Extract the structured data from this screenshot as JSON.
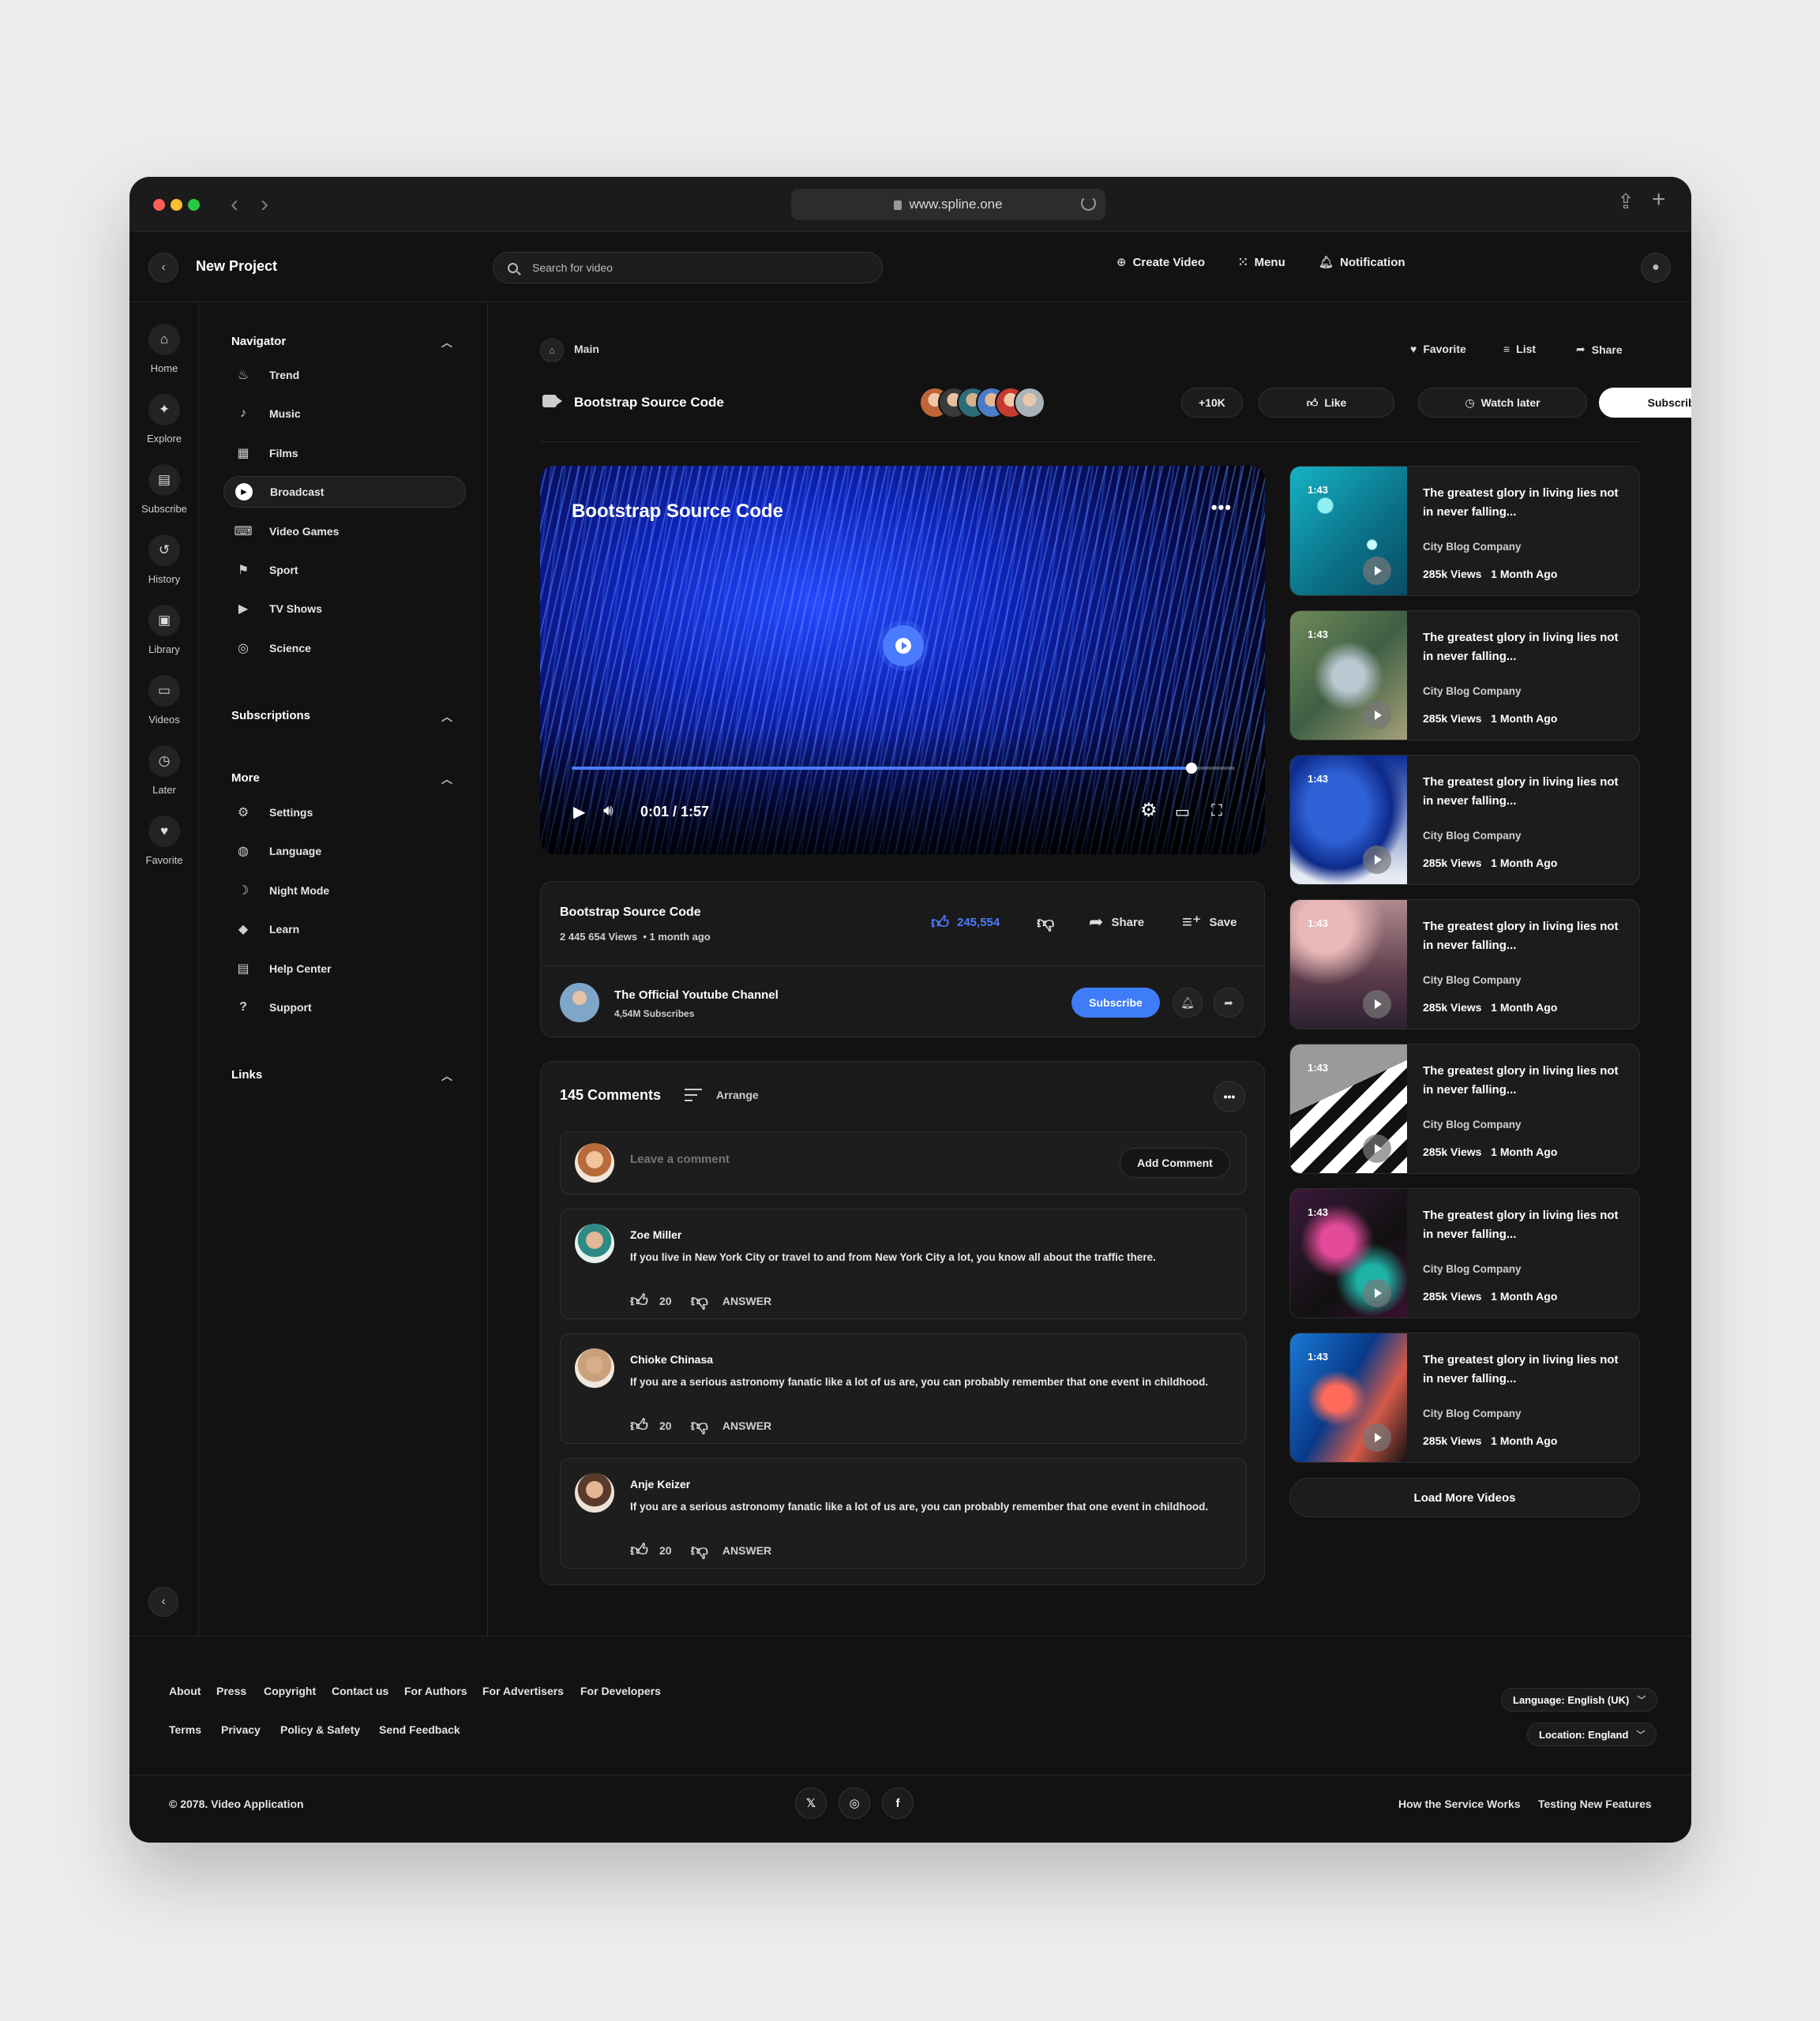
{
  "browser": {
    "url": "www.spline.one"
  },
  "header": {
    "project_title": "New Project",
    "search_placeholder": "Search for video",
    "create_video": "Create Video",
    "menu": "Menu",
    "notification": "Notification"
  },
  "rail": [
    {
      "label": "Home",
      "icon": "home-icon",
      "glyph": "⌂"
    },
    {
      "label": "Explore",
      "icon": "compass-icon",
      "glyph": "✦"
    },
    {
      "label": "Subscribe",
      "icon": "subscribe-icon",
      "glyph": "▤"
    },
    {
      "label": "History",
      "icon": "history-icon",
      "glyph": "↺"
    },
    {
      "label": "Library",
      "icon": "library-icon",
      "glyph": "▣"
    },
    {
      "label": "Videos",
      "icon": "tv-icon",
      "glyph": "▭"
    },
    {
      "label": "Later",
      "icon": "clock-icon",
      "glyph": "◷"
    },
    {
      "label": "Favorite",
      "icon": "heart-icon",
      "glyph": "♥"
    }
  ],
  "navigator": {
    "title": "Navigator",
    "items": [
      {
        "label": "Trend",
        "icon": "flame-icon",
        "glyph": "♨"
      },
      {
        "label": "Music",
        "icon": "music-note-icon",
        "glyph": "♪"
      },
      {
        "label": "Films",
        "icon": "film-icon",
        "glyph": "▦"
      },
      {
        "label": "Broadcast",
        "icon": "play-circle-icon",
        "glyph": "▶"
      },
      {
        "label": "Video Games",
        "icon": "gamepad-icon",
        "glyph": "⌨"
      },
      {
        "label": "Sport",
        "icon": "running-icon",
        "glyph": "⚑"
      },
      {
        "label": "TV Shows",
        "icon": "tv-shows-icon",
        "glyph": "▶"
      },
      {
        "label": "Science",
        "icon": "atom-icon",
        "glyph": "◎"
      }
    ]
  },
  "subscriptions": {
    "title": "Subscriptions"
  },
  "more": {
    "title": "More",
    "items": [
      {
        "label": "Settings",
        "icon": "gear-icon",
        "glyph": "⚙"
      },
      {
        "label": "Language",
        "icon": "globe-icon",
        "glyph": "◍"
      },
      {
        "label": "Night Mode",
        "icon": "moon-icon",
        "glyph": "☽"
      },
      {
        "label": "Learn",
        "icon": "graduation-cap-icon",
        "glyph": "◆"
      },
      {
        "label": "Help Center",
        "icon": "document-icon",
        "glyph": "▤"
      },
      {
        "label": "Support",
        "icon": "question-icon",
        "glyph": "?"
      }
    ]
  },
  "links": {
    "title": "Links"
  },
  "breadcrumb": {
    "label": "Main"
  },
  "top_actions": {
    "favorite": "Favorite",
    "list": "List",
    "share": "Share"
  },
  "video_header": {
    "title": "Bootstrap Source Code",
    "viewers_count": "+10K",
    "like": "Like",
    "watch_later": "Watch later",
    "subscribe": "Subscribe"
  },
  "player": {
    "title": "Bootstrap Source Code",
    "time": "0:01 / 1:57",
    "progress": 0.935
  },
  "video_info": {
    "title": "Bootstrap Source Code",
    "views": "2 445 654 Views",
    "age": "• 1 month ago",
    "likes": "245,554",
    "share": "Share",
    "save": "Save",
    "channel_name": "The Official Youtube Channel",
    "channel_subs": "4,54M Subscribes",
    "subscribe": "Subscribe"
  },
  "comments": {
    "count_label": "145 Comments",
    "arrange": "Arrange",
    "leave_placeholder": "Leave a comment",
    "add_button": "Add Comment",
    "items": [
      {
        "name": "Zoe Miller",
        "text": "If you live in New York City or travel to and from New York City a lot, you know all about the traffic there.",
        "likes": "20",
        "answer": "ANSWER"
      },
      {
        "name": "Chioke Chinasa",
        "text": "If you are a serious astronomy fanatic like a lot of us are, you can probably remember that one event in childhood.",
        "likes": "20",
        "answer": "ANSWER"
      },
      {
        "name": "Anje Keizer",
        "text": "If you are a serious astronomy fanatic like a lot of us are, you can probably remember that one event in childhood.",
        "likes": "20",
        "answer": "ANSWER"
      }
    ]
  },
  "side_videos": [
    {
      "duration": "1:43",
      "title": "The greatest glory in living lies not in never falling...",
      "channel": "City Blog Company",
      "views": "285k Views",
      "age": "1 Month Ago"
    },
    {
      "duration": "1:43",
      "title": "The greatest glory in living lies not in never falling...",
      "channel": "City Blog Company",
      "views": "285k Views",
      "age": "1 Month Ago"
    },
    {
      "duration": "1:43",
      "title": "The greatest glory in living lies not in never falling...",
      "channel": "City Blog Company",
      "views": "285k Views",
      "age": "1 Month Ago"
    },
    {
      "duration": "1:43",
      "title": "The greatest glory in living lies not in never falling...",
      "channel": "City Blog Company",
      "views": "285k Views",
      "age": "1 Month Ago"
    },
    {
      "duration": "1:43",
      "title": "The greatest glory in living lies not in never falling...",
      "channel": "City Blog Company",
      "views": "285k Views",
      "age": "1 Month Ago"
    },
    {
      "duration": "1:43",
      "title": "The greatest glory in living lies not in never falling...",
      "channel": "City Blog Company",
      "views": "285k Views",
      "age": "1 Month Ago"
    },
    {
      "duration": "1:43",
      "title": "The greatest glory in living lies not in never falling...",
      "channel": "City Blog Company",
      "views": "285k Views",
      "age": "1 Month Ago"
    }
  ],
  "load_more": "Load More Videos",
  "footer": {
    "links_row1": [
      "About",
      "Press",
      "Copyright",
      "Contact us",
      "For Authors",
      "For Advertisers",
      "For Developers"
    ],
    "links_row2": [
      "Terms",
      "Privacy",
      "Policy & Safety",
      "Send Feedback"
    ],
    "language": "Language: English (UK)",
    "location": "Location: England",
    "copyright": "© 2078. Video Application",
    "how_it_works": "How the Service Works",
    "testing": "Testing New Features",
    "social": [
      {
        "icon": "x-twitter-icon",
        "glyph": "𝕏"
      },
      {
        "icon": "instagram-icon",
        "glyph": "◎"
      },
      {
        "icon": "facebook-icon",
        "glyph": "f"
      }
    ]
  }
}
